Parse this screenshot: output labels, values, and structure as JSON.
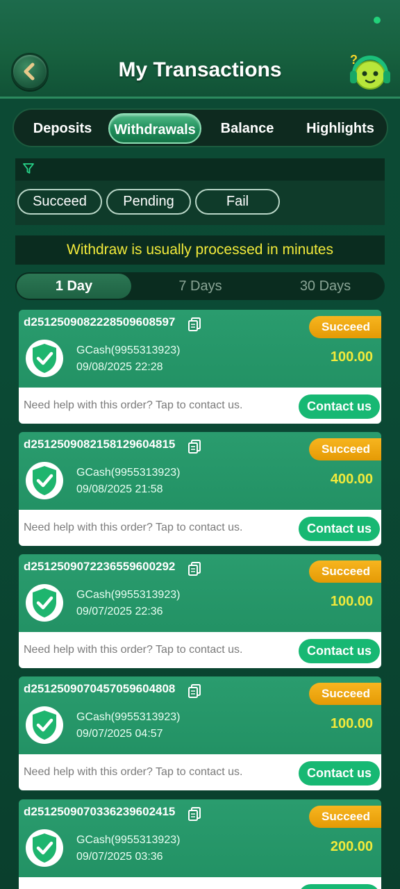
{
  "header": {
    "title": "My Transactions",
    "back_icon": "back-arrow-icon",
    "support_icon": "support-headset-icon"
  },
  "tabs": [
    {
      "label": "Deposits",
      "active": false
    },
    {
      "label": "Withdrawals",
      "active": true
    },
    {
      "label": "Balance",
      "active": false
    },
    {
      "label": "Highlights",
      "active": false
    }
  ],
  "filter": {
    "icon": "filter-icon",
    "chips": [
      "Succeed",
      "Pending",
      "Fail"
    ]
  },
  "notice": "Withdraw is usually processed in minutes",
  "days": [
    {
      "label": "1 Day",
      "active": true
    },
    {
      "label": "7 Days",
      "active": false
    },
    {
      "label": "30 Days",
      "active": false
    }
  ],
  "help_text": "Need help with this order? Tap to contact us.",
  "contact_label": "Contact us",
  "colors": {
    "accent_yellow": "#f2ea3b",
    "badge_orange": "#f0a811",
    "contact_green": "#17b873"
  },
  "transactions": [
    {
      "id": "d2512509082228509608597",
      "status": "Succeed",
      "method": "GCash(9955313923)",
      "time": "09/08/2025 22:28",
      "amount": "100.00"
    },
    {
      "id": "d2512509082158129604815",
      "status": "Succeed",
      "method": "GCash(9955313923)",
      "time": "09/08/2025 21:58",
      "amount": "400.00"
    },
    {
      "id": "d2512509072236559600292",
      "status": "Succeed",
      "method": "GCash(9955313923)",
      "time": "09/07/2025 22:36",
      "amount": "100.00"
    },
    {
      "id": "d2512509070457059604808",
      "status": "Succeed",
      "method": "GCash(9955313923)",
      "time": "09/07/2025 04:57",
      "amount": "100.00"
    },
    {
      "id": "d2512509070336239602415",
      "status": "Succeed",
      "method": "GCash(9955313923)",
      "time": "09/07/2025 03:36",
      "amount": "200.00"
    }
  ]
}
